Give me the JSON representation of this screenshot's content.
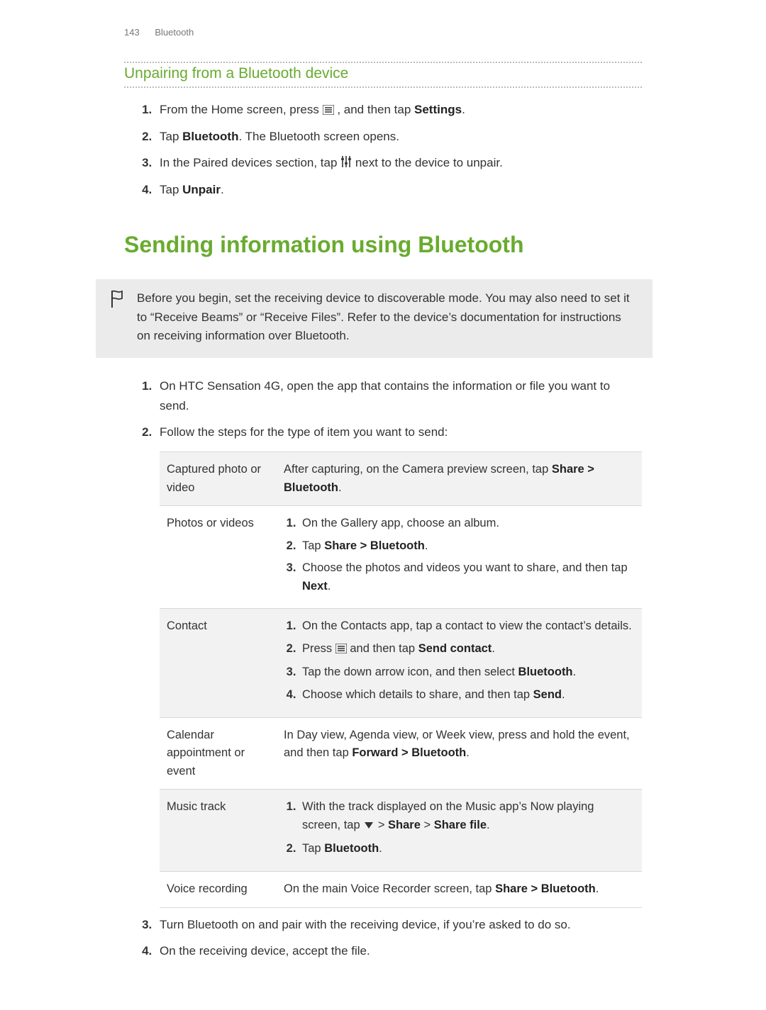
{
  "header": {
    "pageNumber": "143",
    "section": "Bluetooth"
  },
  "unpair": {
    "title": "Unpairing from a Bluetooth device",
    "steps": {
      "s1a": "From the Home screen, press ",
      "s1b": ", and then tap ",
      "s1c": "Settings",
      "s1d": ".",
      "s2a": "Tap ",
      "s2b": "Bluetooth",
      "s2c": ". The Bluetooth screen opens.",
      "s3a": "In the Paired devices section, tap ",
      "s3b": " next to the device to unpair.",
      "s4a": "Tap ",
      "s4b": "Unpair",
      "s4c": "."
    }
  },
  "sending": {
    "title": "Sending information using Bluetooth",
    "note": "Before you begin, set the receiving device to discoverable mode. You may also need to set it to “Receive Beams” or “Receive Files”. Refer to the device’s documentation for instructions on receiving information over Bluetooth.",
    "steps": {
      "s1": "On HTC Sensation 4G, open the app that contains the information or file you want to send.",
      "s2": "Follow the steps for the type of item you want to send:",
      "s3": "Turn Bluetooth on and pair with the receiving device, if you’re asked to do so.",
      "s4": "On the receiving device, accept the file."
    },
    "table": {
      "r0": {
        "key": "Captured photo or video",
        "a": "After capturing, on the Camera preview screen, tap ",
        "b": "Share > Bluetooth",
        "c": "."
      },
      "r1": {
        "key": "Photos or videos",
        "i1": "On the Gallery app, choose an album.",
        "i2a": "Tap ",
        "i2b": "Share > Bluetooth",
        "i2c": ".",
        "i3a": "Choose the photos and videos you want to share, and then tap ",
        "i3b": "Next",
        "i3c": "."
      },
      "r2": {
        "key": "Contact",
        "i1": "On the Contacts app, tap a contact to view the contact’s details.",
        "i2a": "Press ",
        "i2b": " and then tap ",
        "i2c": "Send contact",
        "i2d": ".",
        "i3a": "Tap the down arrow icon, and then select ",
        "i3b": "Bluetooth",
        "i3c": ".",
        "i4a": "Choose which details to share, and then tap ",
        "i4b": "Send",
        "i4c": "."
      },
      "r3": {
        "key": "Calendar appointment or event",
        "a": "In Day view, Agenda view, or Week view, press and hold the event, and then tap ",
        "b": "Forward > Bluetooth",
        "c": "."
      },
      "r4": {
        "key": "Music track",
        "i1a": "With the track displayed on the Music app’s Now playing screen, tap ",
        "i1b": " > ",
        "i1c": "Share",
        "i1d": " > ",
        "i1e": "Share file",
        "i1f": ".",
        "i2a": "Tap ",
        "i2b": "Bluetooth",
        "i2c": "."
      },
      "r5": {
        "key": "Voice recording",
        "a": "On the main Voice Recorder screen, tap ",
        "b": "Share > Bluetooth",
        "c": "."
      }
    }
  }
}
